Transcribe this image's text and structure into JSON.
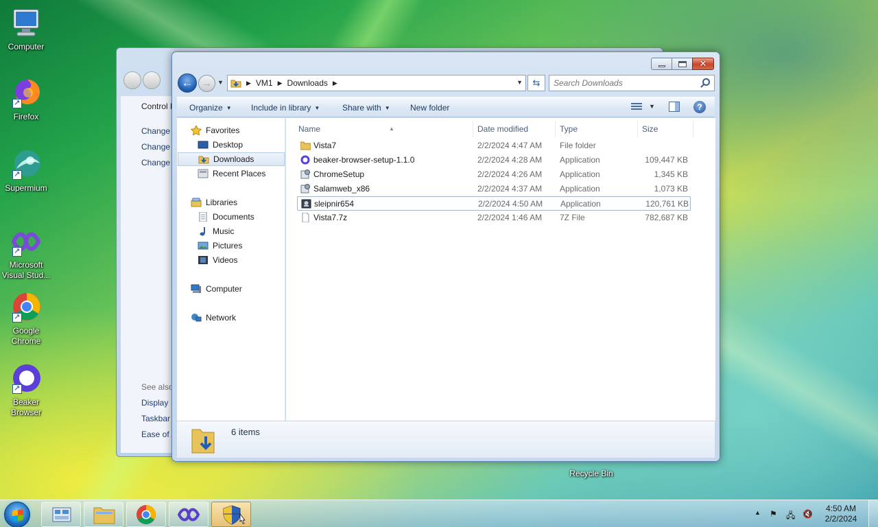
{
  "desktop": {
    "icons": [
      {
        "label": "Computer"
      },
      {
        "label": "Firefox"
      },
      {
        "label": "Supermium"
      },
      {
        "label": "Microsoft Visual Stud..."
      },
      {
        "label": "Google Chrome"
      },
      {
        "label": "Beaker Browser"
      }
    ],
    "recycle_bin": "Recycle Bin"
  },
  "control_panel": {
    "title_partial": "Control P",
    "links": [
      "Change",
      "Change",
      "Change"
    ],
    "see_also": "See also",
    "see_also_links": [
      "Display",
      "Taskbar",
      "Ease of A"
    ]
  },
  "explorer": {
    "address": {
      "crumbs": [
        "VM1",
        "Downloads"
      ]
    },
    "search_placeholder": "Search Downloads",
    "toolbar": {
      "organize": "Organize",
      "include_in_library": "Include in library",
      "share_with": "Share with",
      "new_folder": "New folder"
    },
    "nav": {
      "favorites": "Favorites",
      "desktop": "Desktop",
      "downloads": "Downloads",
      "recent_places": "Recent Places",
      "libraries": "Libraries",
      "documents": "Documents",
      "music": "Music",
      "pictures": "Pictures",
      "videos": "Videos",
      "computer": "Computer",
      "network": "Network"
    },
    "columns": {
      "name": "Name",
      "date_modified": "Date modified",
      "type": "Type",
      "size": "Size"
    },
    "files": [
      {
        "name": "Vista7",
        "date": "2/2/2024 4:47 AM",
        "type": "File folder",
        "size": "",
        "icon": "folder-icon"
      },
      {
        "name": "beaker-browser-setup-1.1.0",
        "date": "2/2/2024 4:28 AM",
        "type": "Application",
        "size": "109,447 KB",
        "icon": "beaker-app-icon"
      },
      {
        "name": "ChromeSetup",
        "date": "2/2/2024 4:26 AM",
        "type": "Application",
        "size": "1,345 KB",
        "icon": "setup-app-icon"
      },
      {
        "name": "Salamweb_x86",
        "date": "2/2/2024 4:37 AM",
        "type": "Application",
        "size": "1,073 KB",
        "icon": "setup-app-icon"
      },
      {
        "name": "sleipnir654",
        "date": "2/2/2024 4:50 AM",
        "type": "Application",
        "size": "120,761 KB",
        "icon": "installer-app-icon"
      },
      {
        "name": "Vista7.7z",
        "date": "2/2/2024 1:46 AM",
        "type": "7Z File",
        "size": "782,687 KB",
        "icon": "file-icon"
      }
    ],
    "status": "6 items"
  },
  "taskbar": {
    "time": "4:50 AM",
    "date": "2/2/2024"
  },
  "colors": {
    "accent": "#1f5fb4",
    "selection": "#dce7f5"
  }
}
